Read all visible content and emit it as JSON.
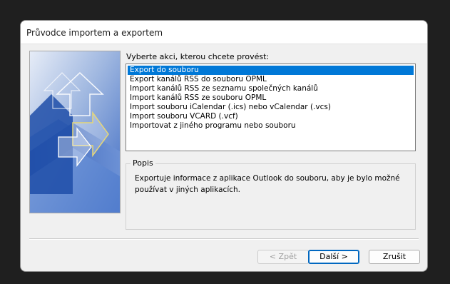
{
  "window": {
    "title": "Průvodce importem a exportem"
  },
  "prompt": "Vyberte akci, kterou chcete provést:",
  "actions": {
    "items": [
      "Export do souboru",
      "Export kanálů RSS do souboru OPML",
      "Import kanálů RSS ze seznamu společných kanálů",
      "Import kanálů RSS ze souboru OPML",
      "Import souboru iCalendar (.ics) nebo vCalendar (.vcs)",
      "Import souboru VCARD (.vcf)",
      "Importovat z jiného programu nebo souboru"
    ],
    "selected_index": 0
  },
  "description": {
    "label": "Popis",
    "text": "Exportuje informace z aplikace Outlook do souboru, aby je bylo možné používat v jiných aplikacích."
  },
  "buttons": {
    "back": "< Zpět",
    "next": "Další >",
    "cancel": "Zrušit"
  },
  "colors": {
    "accent": "#0078d7",
    "dialog_bg": "#f0f0f0",
    "desktop_bg": "#1f1f1f"
  },
  "icons": {
    "wizard_graphic": "import-export-arrows-graphic"
  }
}
